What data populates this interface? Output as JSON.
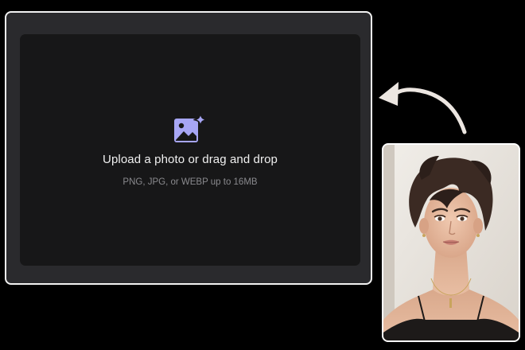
{
  "upload": {
    "title": "Upload a photo or drag and drop",
    "subtitle": "PNG, JPG, or WEBP up to 16MB",
    "icon": "image-sparkle-icon",
    "accent_color": "#a7a6f5"
  },
  "sample_photo": {
    "description_icon": "portrait-photo"
  },
  "colors": {
    "background": "#000000",
    "panel": "#2a2a2d",
    "dropzone": "#171718",
    "arrow": "#ece6e1"
  }
}
